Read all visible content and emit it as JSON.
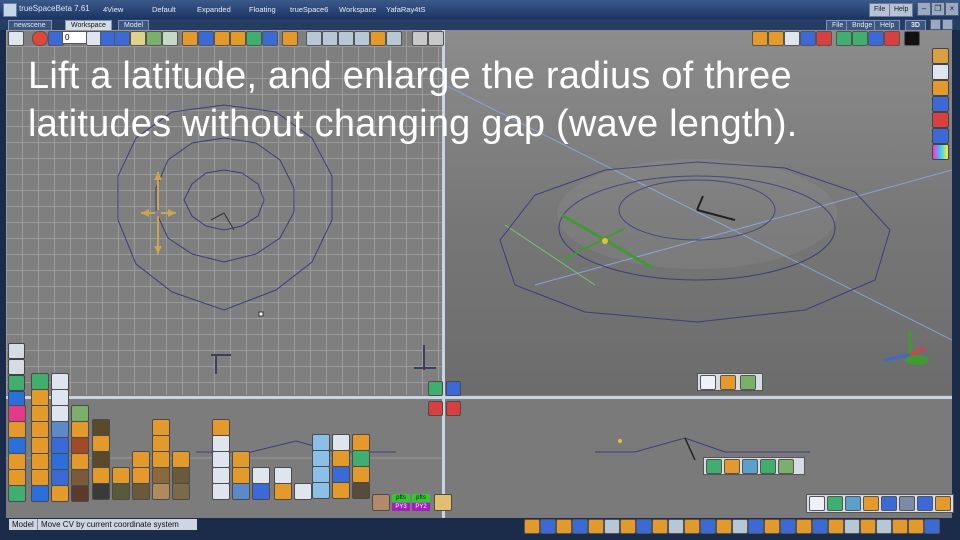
{
  "titlebar": {
    "app_title": "trueSpaceBeta 7.61",
    "workspaces": [
      "4View",
      "Default",
      "Expanded",
      "Floating",
      "trueSpace6",
      "Workspace",
      "YafaRay4tS"
    ],
    "menu_file": "File",
    "menu_help": "Help"
  },
  "tabrow": {
    "scene_tab": "newscene",
    "workspace_tab": "Workspace",
    "model_tab": "Model",
    "menus": [
      "File",
      "Bridge",
      "Help"
    ],
    "view_mode": "3D"
  },
  "toolbar": {
    "frame_value": "0"
  },
  "caption": {
    "line1": "Lift a latitude, and  enlarge the radius of three",
    "line2": "latitudes without changing gap (wave length)."
  },
  "timeline_labels": {
    "top1": "pfts",
    "top2": "pfts",
    "bottom1": "PY3",
    "bottom2": "PY2"
  },
  "statusbar": {
    "mode": "Model",
    "message": "Move CV by current coordinate system"
  },
  "colors": {
    "accent_orange": "#e39a2b",
    "axis_green": "#3f9a33",
    "axis_blue": "#3b69d6",
    "axis_red": "#d84040",
    "wire": "#3b3f78"
  }
}
